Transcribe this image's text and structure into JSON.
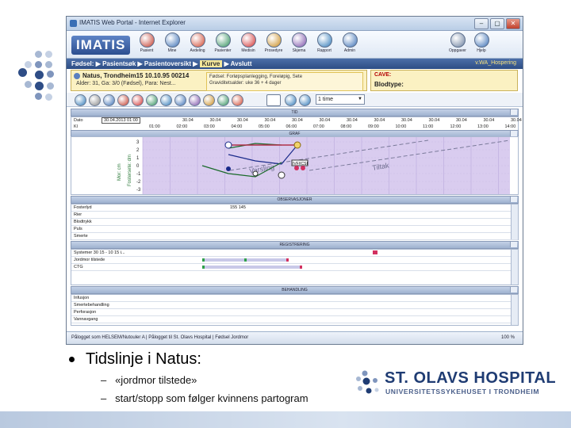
{
  "window": {
    "title": "IMATIS Web Portal - Internet Explorer",
    "buttons": [
      "–",
      "▢",
      "✕"
    ]
  },
  "app": {
    "logo": "IMATIS",
    "toolbar_buttons": [
      {
        "label": "Pasient",
        "color": "#c23a2a"
      },
      {
        "label": "Mine",
        "color": "#3a6fb5"
      },
      {
        "label": "Avdeling",
        "color": "#d0452d"
      },
      {
        "label": "Pasienter",
        "color": "#2f8f5a"
      },
      {
        "label": "Medisin",
        "color": "#d23030"
      },
      {
        "label": "Prosedyre",
        "color": "#c98b1e"
      },
      {
        "label": "Skjema",
        "color": "#7b4fa8"
      },
      {
        "label": "Rapport",
        "color": "#2f79b8"
      },
      {
        "label": "Admin",
        "color": "#3a6fb5"
      },
      {
        "label": "Oppgaver",
        "color": "#6a7f9e"
      },
      {
        "label": "Hjelp",
        "color": "#3a6fb5"
      }
    ]
  },
  "navbar": {
    "crumbs": [
      "Fødsel:",
      "Pasientsøk",
      "Pasientoversikt"
    ],
    "current": "Kurve",
    "after": "Avslutt",
    "user": "v.WA_Hospering"
  },
  "patient": {
    "name": "Natus, Trondheim15 10.10.95 00214",
    "details": "Alder: 31, Ga: 3/0 (Fødsel), Para: Nest...",
    "banner_lines": [
      "Fødsel: Forløpsplanlegging, Foreløpig, Sete",
      "Graviditetsalder: uke 36 + 4 dager"
    ]
  },
  "cave": {
    "label": "CAVE:",
    "blood_label": "Blodtype:"
  },
  "tools": {
    "time_range": "1 time"
  },
  "sections": {
    "time": "TID",
    "graph": "GRAF",
    "observations": "OBSERVASJONER",
    "registrations": "REGISTRERING",
    "treatment": "BEHANDLING"
  },
  "timeline": {
    "row_labels": [
      "Dato",
      "Kl"
    ],
    "selected_date": "30.04.2013 01:00",
    "dates": [
      "30.04",
      "30.04",
      "30.04",
      "30.04",
      "30.04",
      "30.04",
      "30.04",
      "30.04",
      "30.04",
      "30.04",
      "30.04",
      "30.04",
      "30.04",
      "30.04"
    ],
    "times": [
      "01:00",
      "02:00",
      "03:00",
      "04:00",
      "05:00",
      "06:00",
      "07:00",
      "08:00",
      "09:00",
      "10:00",
      "11:00",
      "12:00",
      "13:00",
      "14:00"
    ]
  },
  "graph": {
    "axis_left_a": "Mor: cm",
    "axis_left_b": "Fostersete: dm",
    "ticks": [
      "3",
      "2",
      "1",
      "0",
      "-1",
      "-2",
      "-3"
    ],
    "annotation_1": "Varsling",
    "annotation_2": "Tiltak",
    "marker_label": "IVF/ICSI"
  },
  "observations": {
    "rows": [
      "Fosterlyd",
      "Rier",
      "Blodtrykk",
      "Puls",
      "Smerte"
    ],
    "fosterlyd_value": "155 145"
  },
  "registrations": {
    "rows": [
      "Systemer 30 15 - 10 15 i...",
      "Jordmor tilstede",
      "CTG"
    ]
  },
  "treatment": {
    "rows": [
      "Infusjon",
      "Smertebehandling",
      "Perforasjon",
      "Vannavgang"
    ]
  },
  "statusbar": {
    "text": "Pålogget som HELSEM/Nutouler A | Pålogget til St. Olavs Hospital | Fødsel Jordmor",
    "zoom": "100 %"
  },
  "slide": {
    "bullet": "Tidslinje i Natus:",
    "sub_items": [
      "«jordmor tilstede»",
      "start/stopp som følger kvinnens partogram"
    ],
    "hospital_name": "ST. OLAVS HOSPITAL",
    "hospital_sub": "UNIVERSITETSSYKEHUSET I TRONDHEIM"
  },
  "colors": {
    "accent": "#2d4d84",
    "graph_band": "#d9ccef",
    "patient_bg": "#fbf1c2",
    "brand_blue": "#1f3c73"
  }
}
